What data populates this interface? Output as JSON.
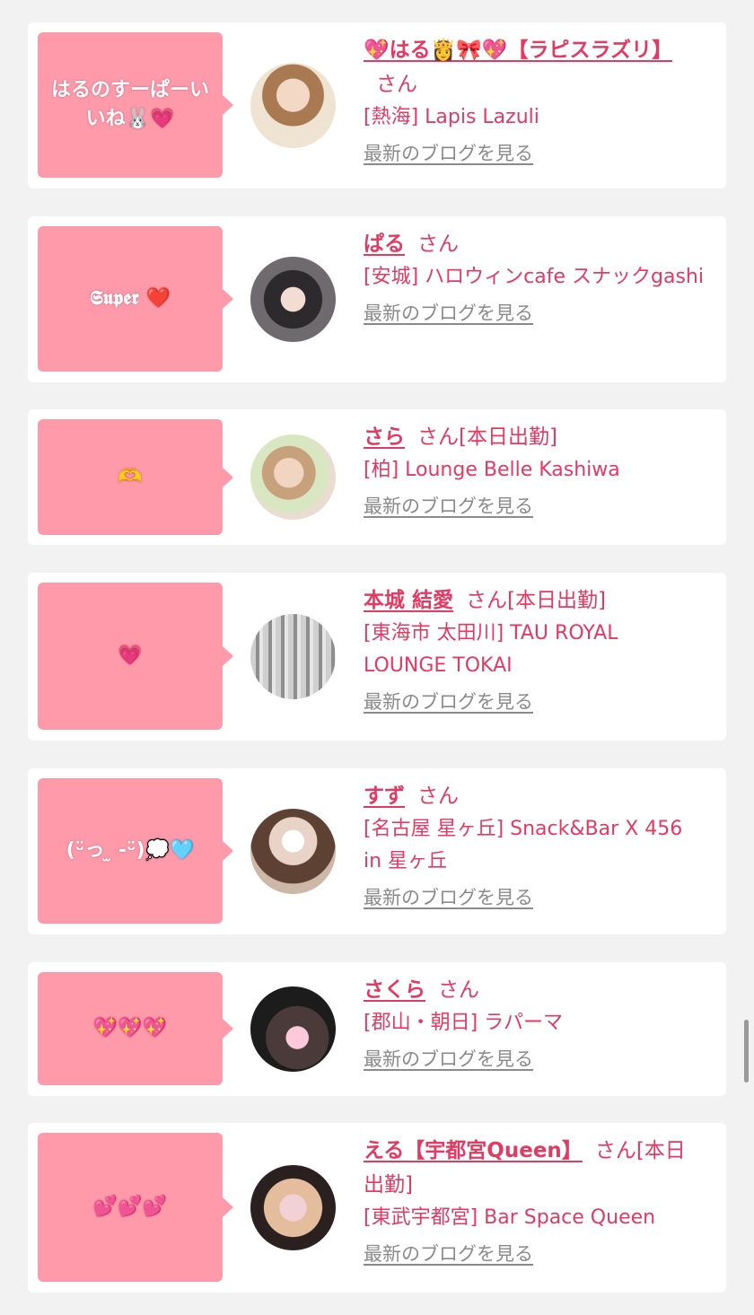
{
  "colors": {
    "accent": "#e23a62",
    "bubble": "#fe9aaa",
    "link_gray": "#8a8a8a",
    "background": "#f2f2f2"
  },
  "entries": [
    {
      "message": "はるのすーぱーいいね🐰💗",
      "name": "💖はる👸🎀💖【ラピスラズリ】",
      "suffix": "さん",
      "status": "",
      "shop": "[熱海] Lapis Lazuli",
      "blog_link": "最新のブログを見る",
      "avatar_icon": "profile-photo"
    },
    {
      "message": "𝕾𝖚𝖕𝖊𝖗 ❤️",
      "name": "ぱる",
      "suffix": "さん",
      "status": "",
      "shop": "[安城] ハロウィンcafe スナックgashi",
      "blog_link": "最新のブログを見る",
      "avatar_icon": "profile-photo"
    },
    {
      "message": "🫶",
      "name": "さら",
      "suffix": "さん",
      "status": "[本日出勤]",
      "shop": "[柏] Lounge Belle Kashiwa",
      "blog_link": "最新のブログを見る",
      "avatar_icon": "profile-photo"
    },
    {
      "message": "💗",
      "name": "本城 結愛",
      "suffix": "さん",
      "status": "[本日出勤]",
      "shop": "[東海市 太田川] TAU ROYAL LOUNGE TOKAI",
      "blog_link": "最新のブログを見る",
      "avatar_icon": "profile-photo"
    },
    {
      "message": "(ᵕ̈っ ̫ -ᵕ̈)💭🩵",
      "name": "すず",
      "suffix": "さん",
      "status": "",
      "shop": "[名古屋 星ヶ丘] Snack&Bar X 456 in 星ヶ丘",
      "blog_link": "最新のブログを見る",
      "avatar_icon": "profile-photo"
    },
    {
      "message": "💖💖💖",
      "name": "さくら",
      "suffix": "さん",
      "status": "",
      "shop": "[郡山・朝日] ラパーマ",
      "blog_link": "最新のブログを見る",
      "avatar_icon": "profile-photo"
    },
    {
      "message": "💕💕💕",
      "name": "える【宇都宮Queen】",
      "suffix": "さん",
      "status": "[本日出勤]",
      "shop": "[東武宇都宮] Bar Space Queen",
      "blog_link": "最新のブログを見る",
      "avatar_icon": "profile-photo"
    }
  ]
}
